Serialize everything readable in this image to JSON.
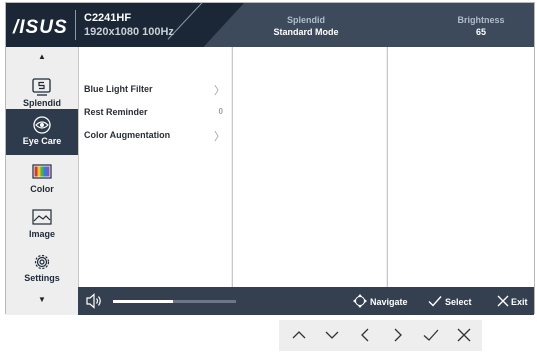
{
  "header": {
    "logo": "/ISUS",
    "model": "C2241HF",
    "resolution": "1920x1080 100Hz",
    "status": [
      {
        "key": "Splendid",
        "value": "Standard Mode"
      },
      {
        "key": "Brightness",
        "value": "65"
      }
    ]
  },
  "sidebar": {
    "items": [
      {
        "label": "Splendid",
        "icon": "splendid-icon"
      },
      {
        "label": "Eye Care",
        "icon": "eye-icon",
        "active": true
      },
      {
        "label": "Color",
        "icon": "color-bars-icon"
      },
      {
        "label": "Image",
        "icon": "image-icon"
      },
      {
        "label": "Settings",
        "icon": "gear-icon"
      }
    ],
    "up_arrow": "▲",
    "down_arrow": "▼"
  },
  "menu": {
    "items": [
      {
        "label": "Blue Light Filter",
        "indicator": "〉"
      },
      {
        "label": "Rest Reminder",
        "value": "0"
      },
      {
        "label": "Color Augmentation",
        "indicator": "〉"
      }
    ]
  },
  "footer": {
    "volume_fraction": 0.49,
    "navigate": "Navigate",
    "select": "Select",
    "exit": "Exit"
  },
  "colors": {
    "header_dark": "#1b2736",
    "header": "#3d4a5b",
    "footer": "#34404f",
    "active_item": "#2e3b4c"
  }
}
